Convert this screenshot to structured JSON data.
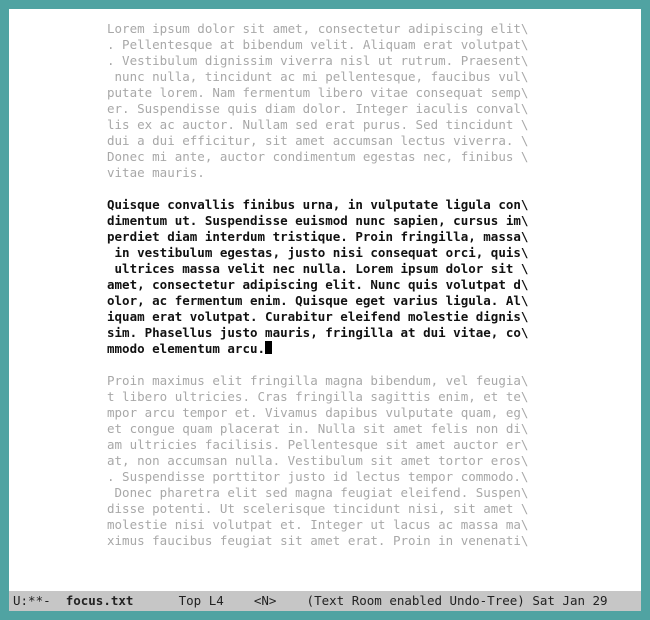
{
  "buffer": {
    "paragraphs": [
      {
        "style": "dim",
        "lines": [
          "Lorem ipsum dolor sit amet, consectetur adipiscing elit\\",
          ". Pellentesque at bibendum velit. Aliquam erat volutpat\\",
          ". Vestibulum dignissim viverra nisl ut rutrum. Praesent\\",
          " nunc nulla, tincidunt ac mi pellentesque, faucibus vul\\",
          "putate lorem. Nam fermentum libero vitae consequat semp\\",
          "er. Suspendisse quis diam dolor. Integer iaculis conval\\",
          "lis ex ac auctor. Nullam sed erat purus. Sed tincidunt \\",
          "dui a dui efficitur, sit amet accumsan lectus viverra. \\",
          "Donec mi ante, auctor condimentum egestas nec, finibus \\",
          "vitae mauris."
        ]
      },
      {
        "style": "focus",
        "lines": [
          "Quisque convallis finibus urna, in vulputate ligula con\\",
          "dimentum ut. Suspendisse euismod nunc sapien, cursus im\\",
          "perdiet diam interdum tristique. Proin fringilla, massa\\",
          " in vestibulum egestas, justo nisi consequat orci, quis\\",
          " ultrices massa velit nec nulla. Lorem ipsum dolor sit \\",
          "amet, consectetur adipiscing elit. Nunc quis volutpat d\\",
          "olor, ac fermentum enim. Quisque eget varius ligula. Al\\",
          "iquam erat volutpat. Curabitur eleifend molestie dignis\\",
          "sim. Phasellus justo mauris, fringilla at dui vitae, co\\",
          "mmodo elementum arcu."
        ],
        "cursor_at_end": true
      },
      {
        "style": "dim",
        "lines": [
          "Proin maximus elit fringilla magna bibendum, vel feugia\\",
          "t libero ultricies. Cras fringilla sagittis enim, et te\\",
          "mpor arcu tempor et. Vivamus dapibus vulputate quam, eg\\",
          "et congue quam placerat in. Nulla sit amet felis non di\\",
          "am ultricies facilisis. Pellentesque sit amet auctor er\\",
          "at, non accumsan nulla. Vestibulum sit amet tortor eros\\",
          ". Suspendisse porttitor justo id lectus tempor commodo.\\",
          " Donec pharetra elit sed magna feugiat eleifend. Suspen\\",
          "disse potenti. Ut scelerisque tincidunt nisi, sit amet \\",
          "molestie nisi volutpat et. Integer ut lacus ac massa ma\\",
          "ximus faucibus feugiat sit amet erat. Proin in venenati\\"
        ]
      }
    ]
  },
  "modeline": {
    "left_status": "U:**-",
    "filename": "focus.txt",
    "position": "Top L4",
    "narrow": "<N>",
    "modes": "(Text Room enabled Undo-Tree)",
    "date": "Sat Jan 29"
  }
}
